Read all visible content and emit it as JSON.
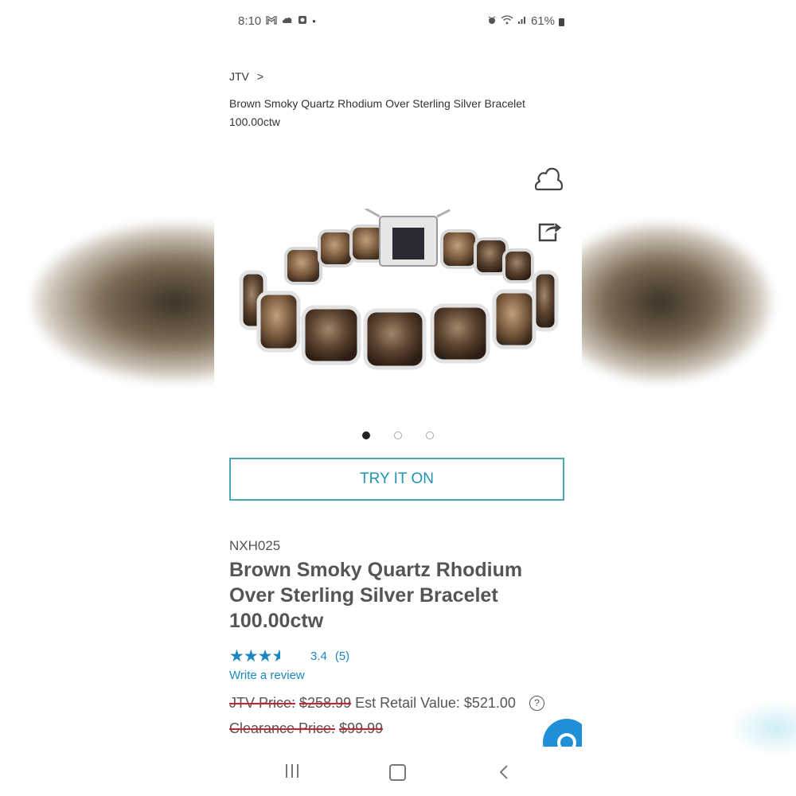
{
  "status_bar": {
    "time": "8:10",
    "left_icons": [
      "gmail-icon",
      "weather-icon",
      "app-icon",
      "dot-icon"
    ],
    "right_icons": [
      "alarm-icon",
      "wifi-icon",
      "signal-icon"
    ],
    "battery": "61%"
  },
  "breadcrumb": {
    "root": "JTV",
    "separator": ">",
    "current": "Brown Smoky Quartz Rhodium Over Sterling Silver Bracelet 100.00ctw"
  },
  "gallery": {
    "image_alt": "smoky quartz bracelet",
    "slide_count": 3,
    "active_slide": 1
  },
  "actions": {
    "try_on_label": "TRY IT ON"
  },
  "product": {
    "sku": "NXH025",
    "title": "Brown Smoky Quartz Rhodium Over Sterling Silver Bracelet 100.00ctw",
    "rating_value": "3.4",
    "rating_count": "(5)",
    "rating_stars": 3.4,
    "write_review": "Write a review",
    "jtv_price_label": "JTV Price:",
    "jtv_price": "$258.99",
    "est_retail_label": "Est Retail Value:",
    "est_retail": "$521.00",
    "clearance_label": "Clearance Price:",
    "clearance_price": "$99.99"
  },
  "colors": {
    "accent": "#1a87c3",
    "button_border": "#4aa7b8",
    "strike": "#d21f2c",
    "fab": "#1f8fd8"
  }
}
